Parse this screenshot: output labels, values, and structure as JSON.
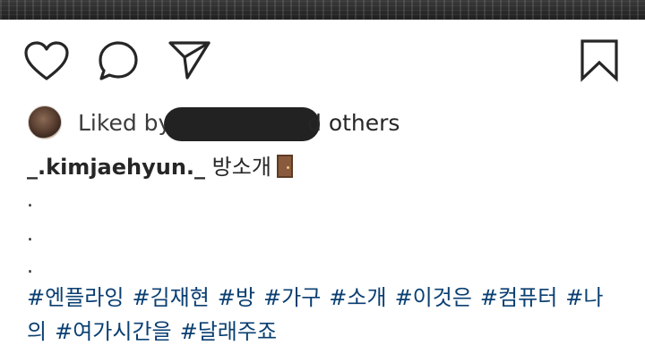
{
  "post": {
    "actions": {
      "like_icon": "heart-outline",
      "comment_icon": "speech-bubble",
      "share_icon": "paper-plane",
      "save_icon": "bookmark-outline"
    },
    "likes": {
      "prefix": "Liked by",
      "suffix_partial": "d",
      "others": "others"
    },
    "caption": {
      "username": "_.kimjaehyun._",
      "text": "방소개"
    },
    "line_dots": [
      ".",
      ".",
      "."
    ],
    "hashtags": [
      "#엔플라잉",
      "#김재현",
      "#방",
      "#가구",
      "#소개",
      "#이것은",
      "#컴퓨터",
      "#나의",
      "#여가시간을",
      "#달래주죠"
    ]
  },
  "colors": {
    "hashtag": "#0a3f72",
    "text": "#262626"
  }
}
